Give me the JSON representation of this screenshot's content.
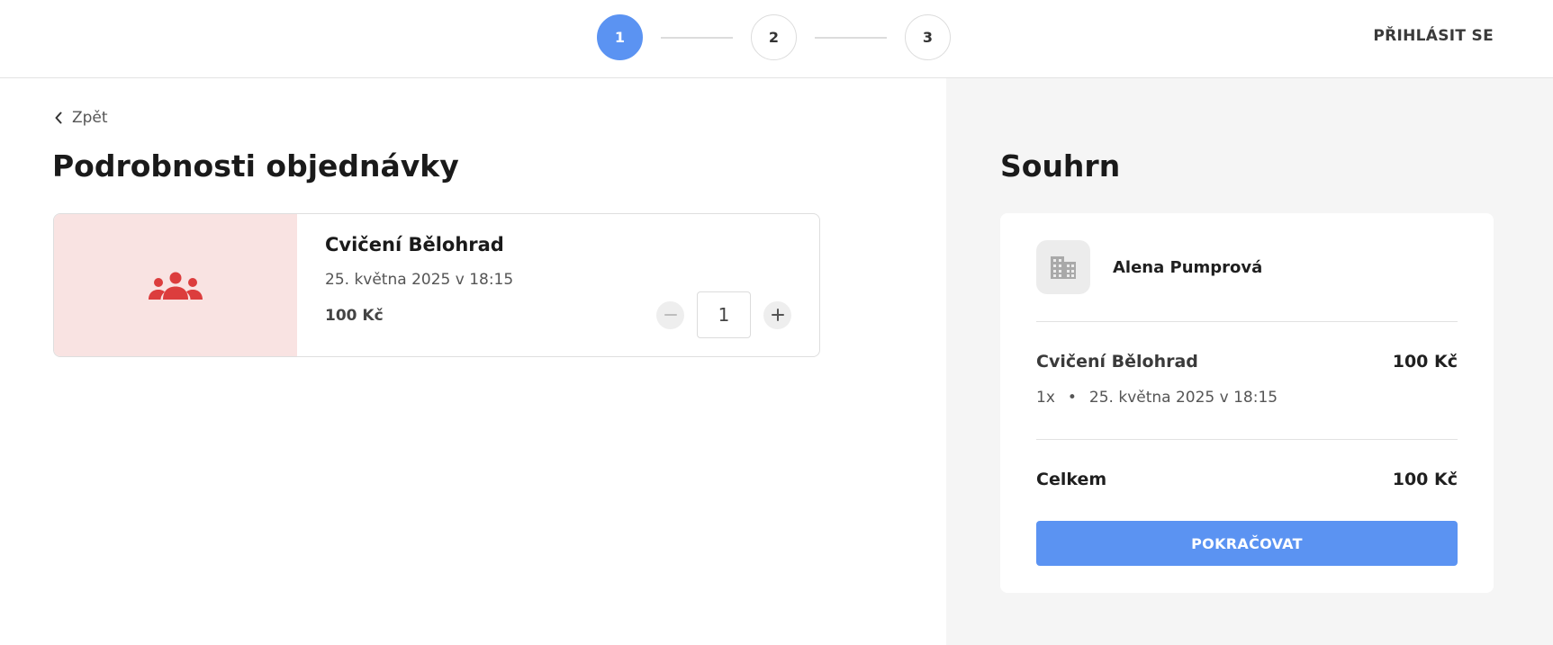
{
  "stepper": {
    "steps": [
      {
        "label": "1",
        "active": true
      },
      {
        "label": "2",
        "active": false
      },
      {
        "label": "3",
        "active": false
      }
    ]
  },
  "header": {
    "login_label": "PŘIHLÁSIT SE"
  },
  "main": {
    "back_label": "Zpět",
    "title": "Podrobnosti objednávky",
    "item": {
      "icon": "group-icon",
      "title": "Cvičení Bělohrad",
      "date": "25. května 2025 v 18:15",
      "price": "100 Kč",
      "quantity": "1"
    }
  },
  "summary": {
    "title": "Souhrn",
    "org_icon": "building-icon",
    "org_name": "Alena Pumprová",
    "item_name": "Cvičení Bělohrad",
    "item_price": "100 Kč",
    "item_qty": "1x",
    "item_separator": "•",
    "item_date": "25. května 2025 v 18:15",
    "total_label": "Celkem",
    "total_value": "100 Kč",
    "continue_label": "POKRAČOVAT"
  },
  "colors": {
    "accent": "#5b93f2",
    "icon_red": "#dc3d3d",
    "thumb_bg": "#f9e3e2",
    "summary_bg": "#f5f5f5"
  }
}
